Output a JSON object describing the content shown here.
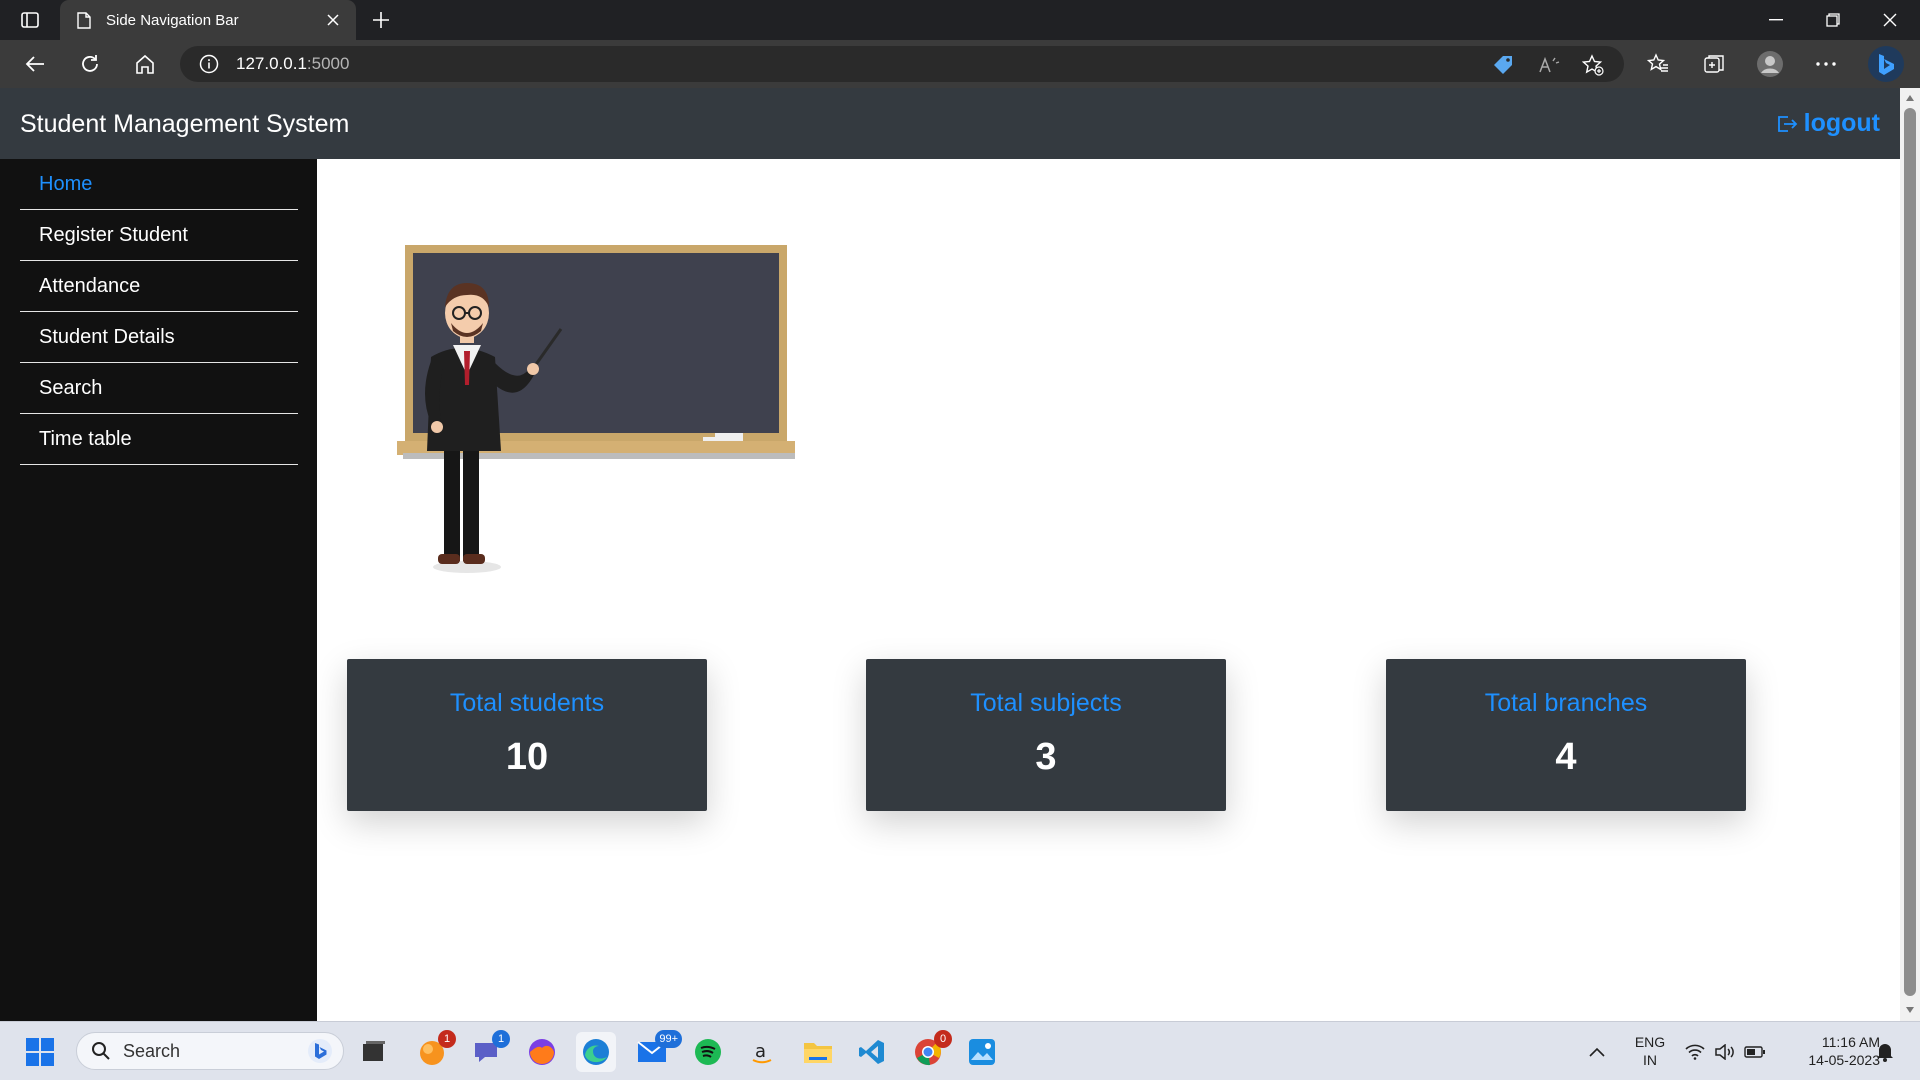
{
  "browser": {
    "tab_title": "Side Navigation Bar",
    "url_host": "127.0.0.1",
    "url_port": ":5000"
  },
  "header": {
    "title": "Student Management System",
    "logout_label": "logout"
  },
  "sidebar": {
    "items": [
      {
        "label": "Home",
        "active": true
      },
      {
        "label": "Register Student",
        "active": false
      },
      {
        "label": "Attendance",
        "active": false
      },
      {
        "label": "Student Details",
        "active": false
      },
      {
        "label": "Search",
        "active": false
      },
      {
        "label": "Time table",
        "active": false
      }
    ]
  },
  "stats": [
    {
      "title": "Total students",
      "value": "10"
    },
    {
      "title": "Total subjects",
      "value": "3"
    },
    {
      "title": "Total branches",
      "value": "4"
    }
  ],
  "taskbar": {
    "search_label": "Search",
    "badges": {
      "app1": "1",
      "teams": "1",
      "mail": "99+",
      "chrome": "0"
    },
    "lang_primary": "ENG",
    "lang_secondary": "IN",
    "time": "11:16 AM",
    "date": "14-05-2023"
  },
  "colors": {
    "accent": "#1e90ff",
    "header_bg": "#343a40",
    "sidebar_bg": "#111111",
    "card_bg": "#343a40"
  }
}
